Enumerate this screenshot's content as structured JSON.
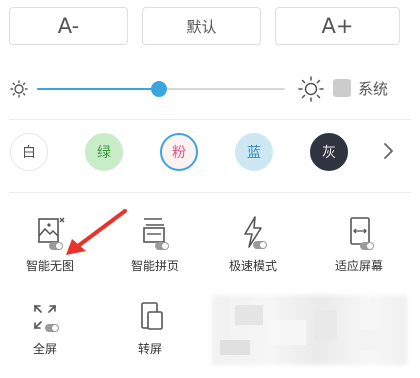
{
  "font_size": {
    "decrease_label": "A-",
    "default_label": "默认",
    "increase_label": "A+"
  },
  "brightness": {
    "level": 0.49,
    "system_label": "系统",
    "accent": "#3ba5e0"
  },
  "themes": [
    {
      "label": "白",
      "bg": "#ffffff",
      "border": "#e6e6e6",
      "text": "#555555"
    },
    {
      "label": "绿",
      "bg": "#c8ecc8",
      "border": "#c8ecc8",
      "text": "#3a9a3a"
    },
    {
      "label": "粉",
      "bg": "#fff2f3",
      "border": "#3ba5e0",
      "text": "#e0548a"
    },
    {
      "label": "蓝",
      "bg": "#cde8f2",
      "border": "#cde8f2",
      "text": "#3a86b8"
    },
    {
      "label": "灰",
      "bg": "#2f3440",
      "border": "#2f3440",
      "text": "#e6e6e6"
    }
  ],
  "tools": [
    {
      "label": "智能无图",
      "icon": "no-image-icon"
    },
    {
      "label": "智能拼页",
      "icon": "page-merge-icon"
    },
    {
      "label": "极速模式",
      "icon": "lightning-icon"
    },
    {
      "label": "适应屏幕",
      "icon": "fit-screen-icon"
    },
    {
      "label": "全屏",
      "icon": "fullscreen-icon"
    },
    {
      "label": "转屏",
      "icon": "rotate-screen-icon"
    }
  ],
  "annotation": {
    "color": "#e8332b"
  }
}
